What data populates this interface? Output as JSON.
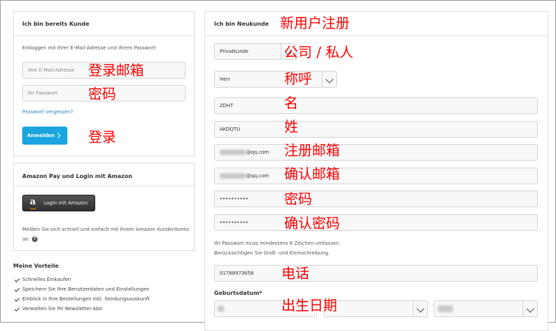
{
  "existing": {
    "title": "Ich bin bereits Kunde",
    "subtitle": "Einloggen mit Ihrer E-Mail-Adresse und Ihrem Passwort",
    "email_placeholder": "Ihre E-Mail-Adresse",
    "password_placeholder": "Ihr Passwort",
    "forgot_link": "Passwort vergessen?",
    "login_button": "Anmelden"
  },
  "amazon": {
    "title": "Amazon Pay und Login mit Amazon",
    "button_label": "Login mit Amazon",
    "desc_line1": "Melden Sie sich schnell und einfach mit Ihrem Amazon Kundenkonto",
    "desc_line2": "an.",
    "help_glyph": "?"
  },
  "benefits": {
    "title": "Meine Vorteile",
    "items": [
      "Schnelles Einkaufen",
      "Speichern Sie Ihre Benutzerdaten und Einstellungen",
      "Einblick in Ihre Bestellungen inkl. Sendungsauskunft",
      "Verwalten Sie Ihr Newsletter-Abo"
    ]
  },
  "new_customer": {
    "title": "Ich bin Neukunde",
    "customer_type": "Privatkunde",
    "salutation": "Herr",
    "first_name": "ZDHT",
    "last_name": "AKOQTU",
    "email_suffix": "@qq.com",
    "email_confirm_suffix": "@qq.com",
    "password": "••••••••••",
    "password_confirm": "••••••••••",
    "password_hint_line1": "Ihr Passwort muss mindestens 8 Zeichen umfassen.",
    "password_hint_line2": "Berücksichtigen Sie Groß- und Kleinschreibung.",
    "phone": "01788973658",
    "birthdate_label": "Geburtsdatum*"
  },
  "annotations": {
    "new_user": "新用户注册",
    "company_private": "公司 / 私人",
    "salutation": "称呼",
    "first_name": "名",
    "last_name": "姓",
    "register_email": "注册邮箱",
    "confirm_email": "确认邮箱",
    "password": "密码",
    "confirm_password": "确认密码",
    "phone": "电话",
    "birthdate": "出生日期",
    "login_email": "登录邮箱",
    "login_password": "密码",
    "login": "登录"
  },
  "colors": {
    "login_button": "#1aa5e0",
    "annotation": "#ff0000",
    "link": "#2a84c2"
  }
}
